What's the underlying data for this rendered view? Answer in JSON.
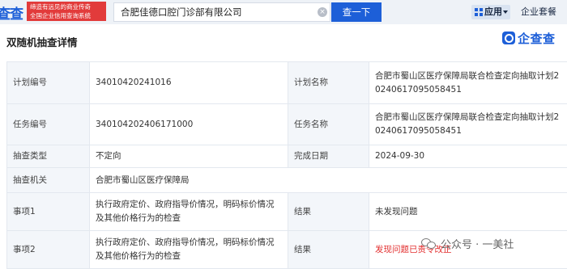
{
  "header": {
    "logo_text": "查查",
    "slogan_line1": "缔造有远见的商业传奇",
    "slogan_line2": "全国企业信用查询系统",
    "search_value": "合肥佳德口腔门诊部有限公司",
    "search_button_label": "查一下",
    "app_menu_label": "应用",
    "package_label": "企业套餐"
  },
  "page": {
    "title": "双随机抽查详情",
    "brand_text": "企查查"
  },
  "detail": {
    "plan_no_label": "计划编号",
    "plan_no_value": "34010420241016",
    "plan_name_label": "计划名称",
    "plan_name_value": "合肥市蜀山区医疗保障局联合检查定向抽取计划20240617095058451",
    "task_no_label": "任务编号",
    "task_no_value": "340104202406171000",
    "task_name_label": "任务名称",
    "task_name_value": "合肥市蜀山区医疗保障局联合检查定向抽取计划20240617095058451",
    "type_label": "抽查类型",
    "type_value": "不定向",
    "done_date_label": "完成日期",
    "done_date_value": "2024-09-30",
    "org_label": "抽查机关",
    "org_value": "合肥市蜀山区医疗保障局",
    "item1_label": "事项1",
    "item1_value": "执行政府定价、政府指导价情况，明码标价情况及其他价格行为的检查",
    "result1_label": "结果",
    "result1_value": "未发现问题",
    "item2_label": "事项2",
    "item2_value": "执行政府定价、政府指导价情况，明码标价情况及其他价格行为的检查",
    "result2_label": "结果",
    "result2_value": "发现问题已责令改正"
  },
  "watermark": {
    "text": "公众号 · 一美社"
  },
  "colors": {
    "accent": "#1d5fd8",
    "alert": "#e22d2d",
    "slogan_bg": "#e23b3b"
  }
}
